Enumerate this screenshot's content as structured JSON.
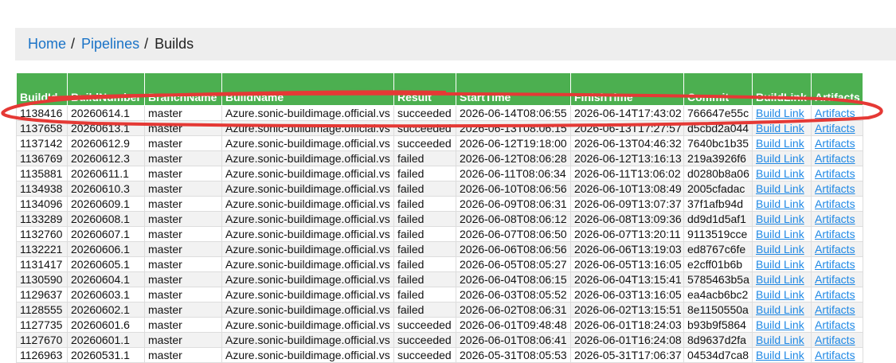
{
  "breadcrumb": {
    "home": "Home",
    "pipelines": "Pipelines",
    "sep": "/",
    "current": "Builds"
  },
  "table": {
    "headers": [
      "BuildId",
      "BuildNumber",
      "BranchName",
      "BuildName",
      "Result",
      "StartTime",
      "FinishTime",
      "Commit",
      "BuildLink",
      "Artifacts"
    ],
    "rows": [
      [
        "1138416",
        "20260614.1",
        "master",
        "Azure.sonic-buildimage.official.vs",
        "succeeded",
        "2026-06-14T08:06:55",
        "2026-06-14T17:43:02",
        "766647e55c",
        "Build Link",
        "Artifacts"
      ],
      [
        "1137658",
        "20260613.1",
        "master",
        "Azure.sonic-buildimage.official.vs",
        "succeeded",
        "2026-06-13T08:06:15",
        "2026-06-13T17:27:57",
        "d5cbd2a044",
        "Build Link",
        "Artifacts"
      ],
      [
        "1137142",
        "20260612.9",
        "master",
        "Azure.sonic-buildimage.official.vs",
        "succeeded",
        "2026-06-12T19:18:00",
        "2026-06-13T04:46:32",
        "7640bc1b35",
        "Build Link",
        "Artifacts"
      ],
      [
        "1136769",
        "20260612.3",
        "master",
        "Azure.sonic-buildimage.official.vs",
        "failed",
        "2026-06-12T08:06:28",
        "2026-06-12T13:16:13",
        "219a3926f6",
        "Build Link",
        "Artifacts"
      ],
      [
        "1135881",
        "20260611.1",
        "master",
        "Azure.sonic-buildimage.official.vs",
        "failed",
        "2026-06-11T08:06:34",
        "2026-06-11T13:06:02",
        "d0280b8a06",
        "Build Link",
        "Artifacts"
      ],
      [
        "1134938",
        "20260610.3",
        "master",
        "Azure.sonic-buildimage.official.vs",
        "failed",
        "2026-06-10T08:06:56",
        "2026-06-10T13:08:49",
        "2005cfadac",
        "Build Link",
        "Artifacts"
      ],
      [
        "1134096",
        "20260609.1",
        "master",
        "Azure.sonic-buildimage.official.vs",
        "failed",
        "2026-06-09T08:06:31",
        "2026-06-09T13:07:37",
        "37f1afb94d",
        "Build Link",
        "Artifacts"
      ],
      [
        "1133289",
        "20260608.1",
        "master",
        "Azure.sonic-buildimage.official.vs",
        "failed",
        "2026-06-08T08:06:12",
        "2026-06-08T13:09:36",
        "dd9d1d5af1",
        "Build Link",
        "Artifacts"
      ],
      [
        "1132760",
        "20260607.1",
        "master",
        "Azure.sonic-buildimage.official.vs",
        "failed",
        "2026-06-07T08:06:50",
        "2026-06-07T13:20:11",
        "9113519cce",
        "Build Link",
        "Artifacts"
      ],
      [
        "1132221",
        "20260606.1",
        "master",
        "Azure.sonic-buildimage.official.vs",
        "failed",
        "2026-06-06T08:06:56",
        "2026-06-06T13:19:03",
        "ed8767c6fe",
        "Build Link",
        "Artifacts"
      ],
      [
        "1131417",
        "20260605.1",
        "master",
        "Azure.sonic-buildimage.official.vs",
        "failed",
        "2026-06-05T08:05:27",
        "2026-06-05T13:16:05",
        "e2cff01b6b",
        "Build Link",
        "Artifacts"
      ],
      [
        "1130590",
        "20260604.1",
        "master",
        "Azure.sonic-buildimage.official.vs",
        "failed",
        "2026-06-04T08:06:15",
        "2026-06-04T13:15:41",
        "5785463b5a",
        "Build Link",
        "Artifacts"
      ],
      [
        "1129637",
        "20260603.1",
        "master",
        "Azure.sonic-buildimage.official.vs",
        "failed",
        "2026-06-03T08:05:52",
        "2026-06-03T13:16:05",
        "ea4acb6bc2",
        "Build Link",
        "Artifacts"
      ],
      [
        "1128555",
        "20260602.1",
        "master",
        "Azure.sonic-buildimage.official.vs",
        "failed",
        "2026-06-02T08:06:31",
        "2026-06-02T13:15:51",
        "8e1150550a",
        "Build Link",
        "Artifacts"
      ],
      [
        "1127735",
        "20260601.6",
        "master",
        "Azure.sonic-buildimage.official.vs",
        "succeeded",
        "2026-06-01T09:48:48",
        "2026-06-01T18:24:03",
        "b93b9f5864",
        "Build Link",
        "Artifacts"
      ],
      [
        "1127670",
        "20260601.1",
        "master",
        "Azure.sonic-buildimage.official.vs",
        "succeeded",
        "2026-06-01T08:06:41",
        "2026-06-01T16:24:08",
        "8d9637d2fa",
        "Build Link",
        "Artifacts"
      ],
      [
        "1126963",
        "20260531.1",
        "master",
        "Azure.sonic-buildimage.official.vs",
        "succeeded",
        "2026-05-31T08:05:53",
        "2026-05-31T17:06:37",
        "04534d7ca8",
        "Build Link",
        "Artifacts"
      ]
    ]
  },
  "colors": {
    "header_bg": "#4caf50",
    "link": "#1e88e5",
    "annotation": "#e53935",
    "breadcrumb_bg": "#eeeeee"
  }
}
